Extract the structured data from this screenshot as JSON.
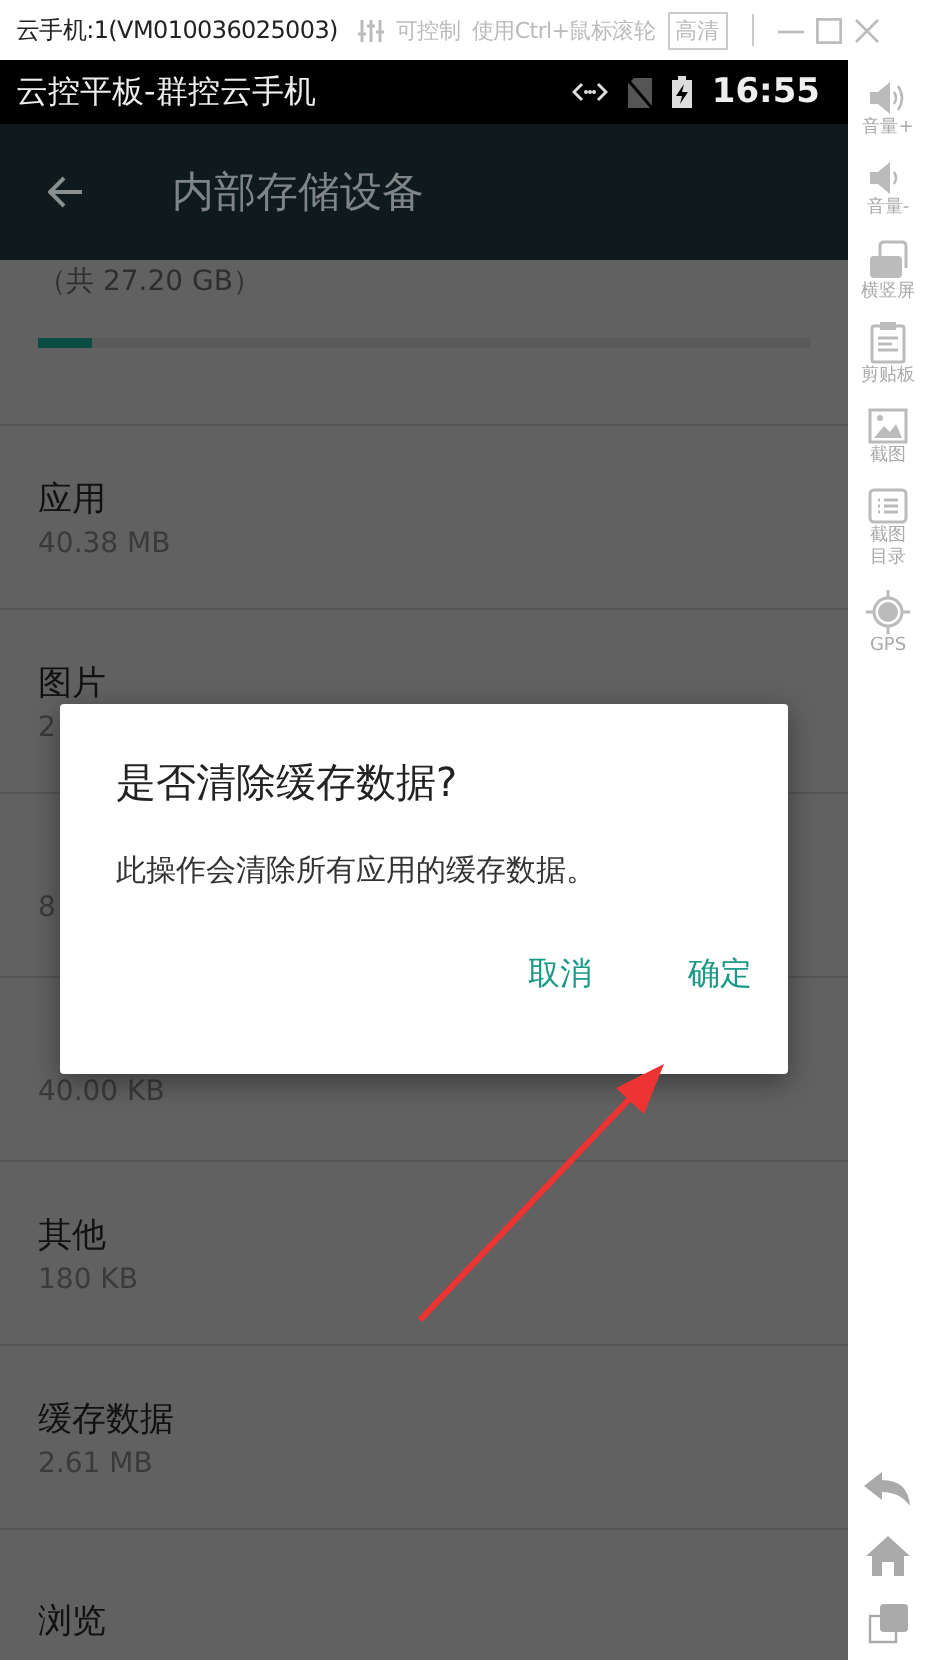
{
  "window": {
    "title": "云手机:1(VM010036025003)",
    "control_label": "可控制",
    "hint": "使用Ctrl+鼠标滚轮",
    "quality": "高清"
  },
  "status_bar": {
    "title": "云控平板-群控云手机",
    "time": "16:55"
  },
  "app_bar": {
    "title": "内部存储设备"
  },
  "storage": {
    "total": "（共 27.20 GB）",
    "level": 0.07
  },
  "items": [
    {
      "title": "应用",
      "value": "40.38 MB"
    },
    {
      "title": "图片",
      "value": "2"
    },
    {
      "value": "8"
    },
    {
      "value": "40.00 KB"
    },
    {
      "title": "其他",
      "value": "180 KB"
    },
    {
      "title": "缓存数据",
      "value": "2.61 MB"
    },
    {
      "title": "浏览"
    }
  ],
  "dialog": {
    "title": "是否清除缓存数据?",
    "message": "此操作会清除所有应用的缓存数据。",
    "buttons": [
      "取消",
      "确定"
    ]
  },
  "sidebar": [
    {
      "kind": "volume-up",
      "label": "音量+"
    },
    {
      "kind": "volume-down",
      "label": "音量-"
    },
    {
      "kind": "rotate",
      "label": "横竖屏"
    },
    {
      "kind": "clipboard",
      "label": "剪贴板"
    },
    {
      "kind": "screenshot",
      "label": "截图"
    },
    {
      "kind": "folder",
      "label": "截图目录"
    },
    {
      "kind": "gps",
      "label": "GPS"
    }
  ]
}
